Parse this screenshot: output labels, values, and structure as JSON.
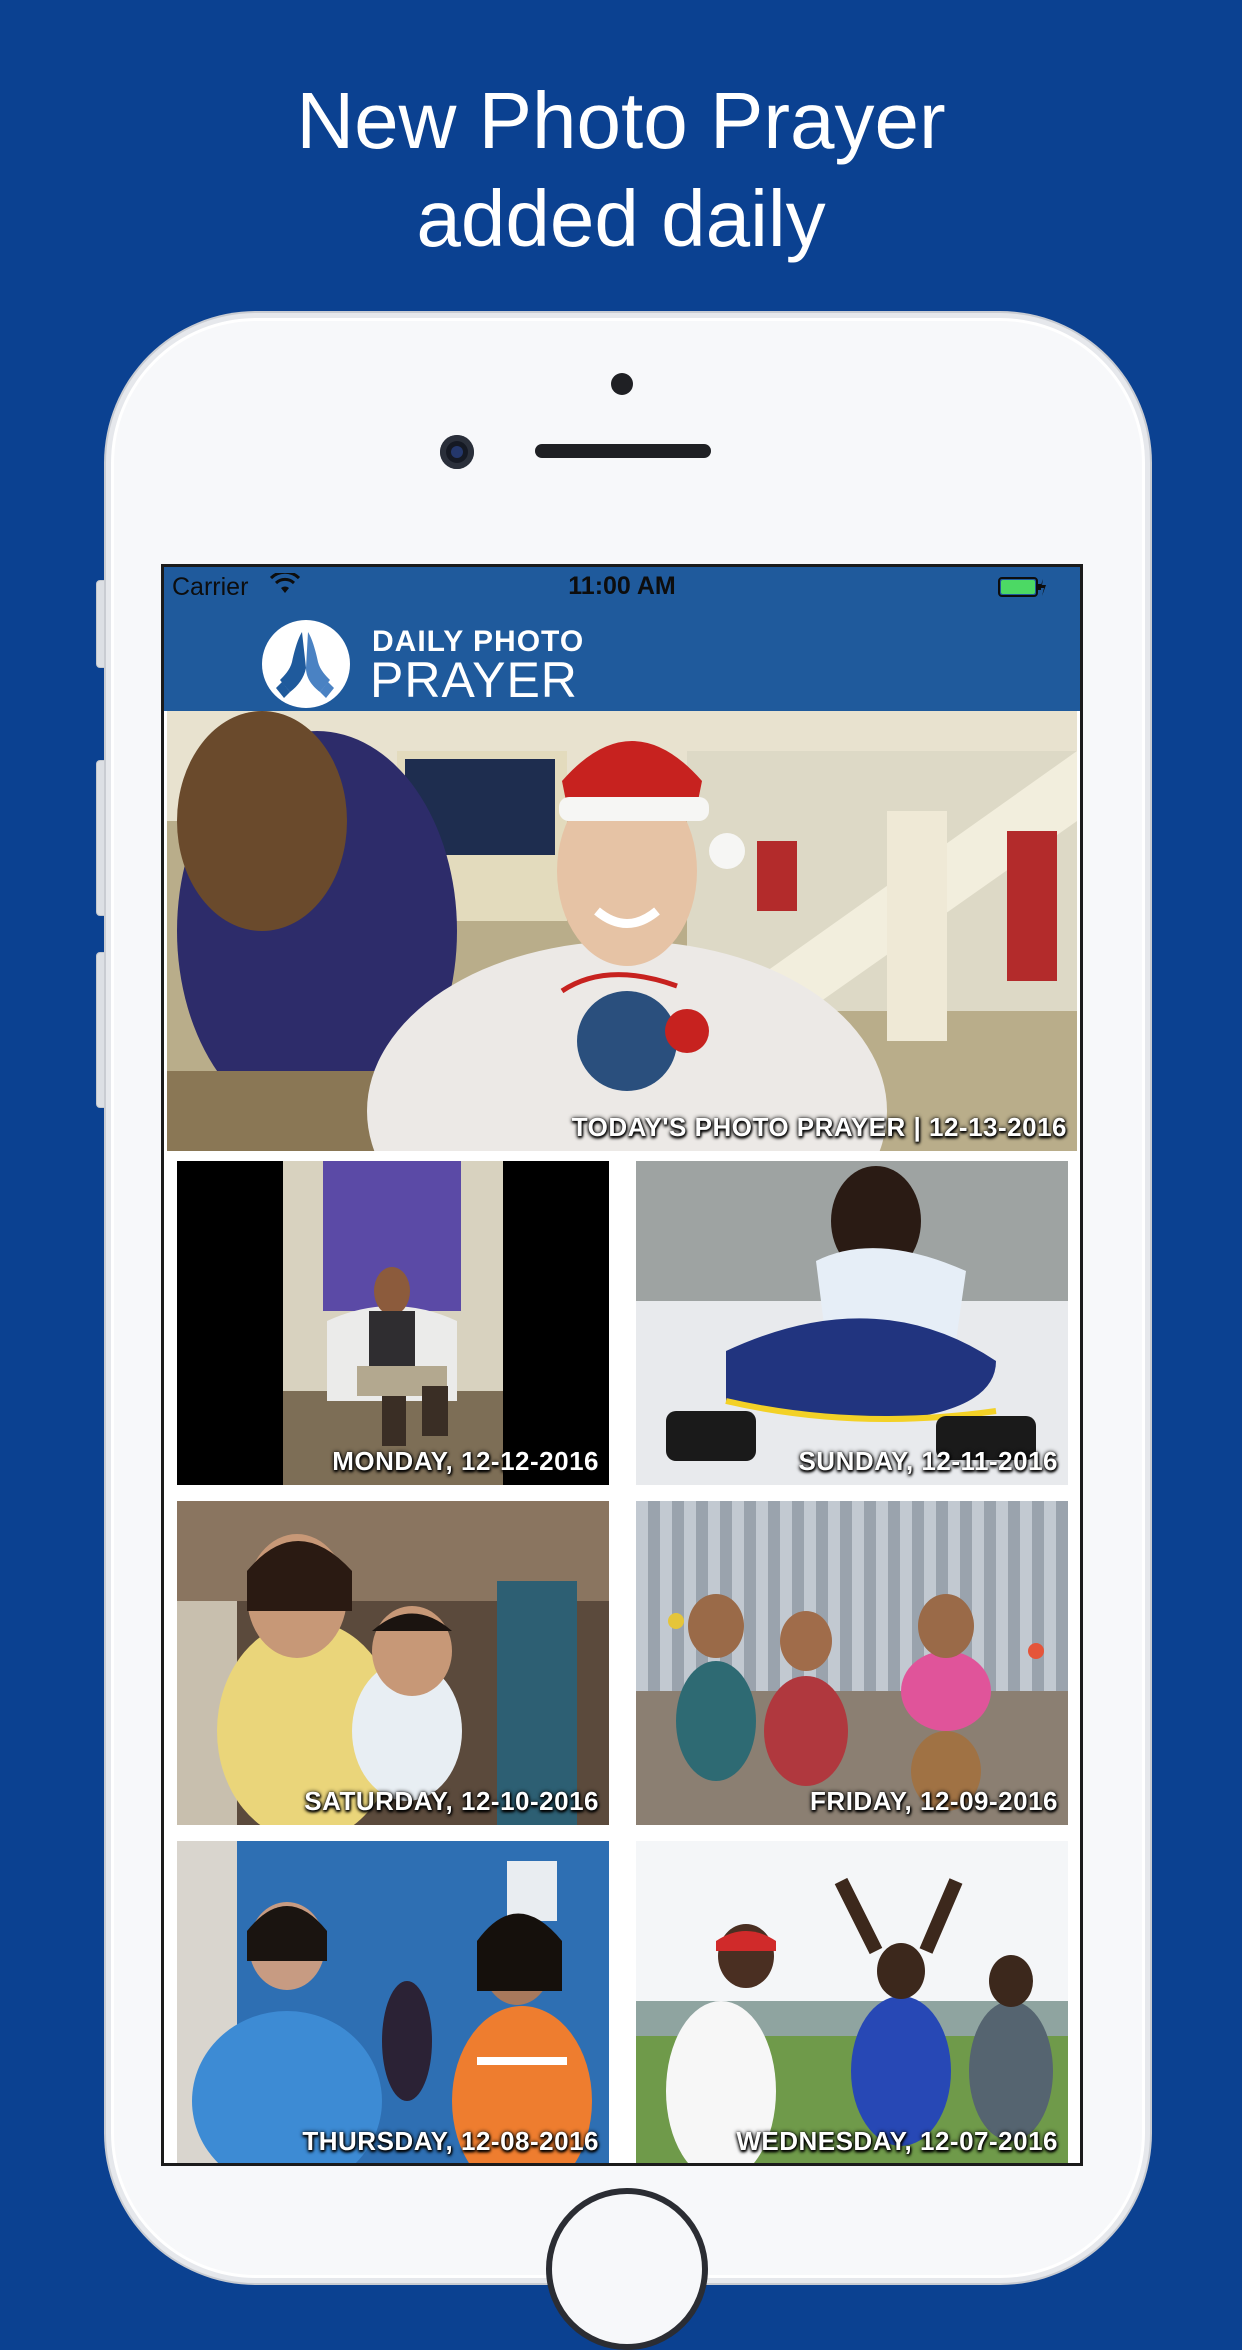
{
  "promo": {
    "headline_line1": "New Photo Prayer",
    "headline_line2": "added daily"
  },
  "status_bar": {
    "carrier": "Carrier",
    "time": "11:00 AM",
    "icons": [
      "wifi-icon",
      "battery-icon"
    ]
  },
  "app_bar": {
    "brand_line1": "DAILY PHOTO",
    "brand_line2": "PRAYER",
    "logo_icon": "praying-hands-icon"
  },
  "hero": {
    "caption": "TODAY'S PHOTO PRAYER | 12-13-2016"
  },
  "grid": [
    {
      "caption": "MONDAY, 12-12-2016"
    },
    {
      "caption": "SUNDAY, 12-11-2016"
    },
    {
      "caption": "SATURDAY, 12-10-2016"
    },
    {
      "caption": "FRIDAY, 12-09-2016"
    },
    {
      "caption": "THURSDAY, 12-08-2016"
    },
    {
      "caption": "WEDNESDAY, 12-07-2016"
    }
  ],
  "colors": {
    "page_background": "#0b4191",
    "app_bar": "#1f5a9c",
    "battery": "#4cd964"
  }
}
